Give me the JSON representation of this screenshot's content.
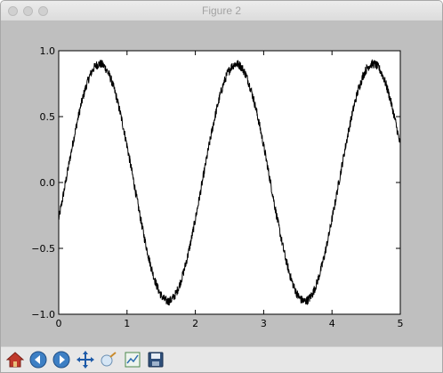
{
  "window": {
    "title": "Figure 2"
  },
  "toolbar": {
    "buttons": [
      {
        "name": "home",
        "icon": "home-icon"
      },
      {
        "name": "back",
        "icon": "back-arrow-icon"
      },
      {
        "name": "forward",
        "icon": "forward-arrow-icon"
      },
      {
        "name": "pan",
        "icon": "move-icon"
      },
      {
        "name": "zoom",
        "icon": "zoom-rect-icon"
      },
      {
        "name": "subplots",
        "icon": "subplots-config-icon"
      },
      {
        "name": "save",
        "icon": "save-disk-icon"
      }
    ]
  },
  "chart_data": {
    "type": "line",
    "title": "",
    "xlabel": "",
    "ylabel": "",
    "xlim": [
      0,
      5
    ],
    "ylim": [
      -1.0,
      1.0
    ],
    "xticks": [
      "0",
      "1",
      "2",
      "3",
      "4",
      "5"
    ],
    "yticks": [
      "1.0",
      "0.5",
      "0.0",
      "−0.5",
      "−1.0"
    ],
    "grid": false,
    "series": [
      {
        "color": "#000000",
        "function": "0.9*sin(pi*(x-0.1)) with small high-frequency noise",
        "amplitude": 0.9,
        "period": 2,
        "noise_amplitude": 0.035
      }
    ]
  }
}
